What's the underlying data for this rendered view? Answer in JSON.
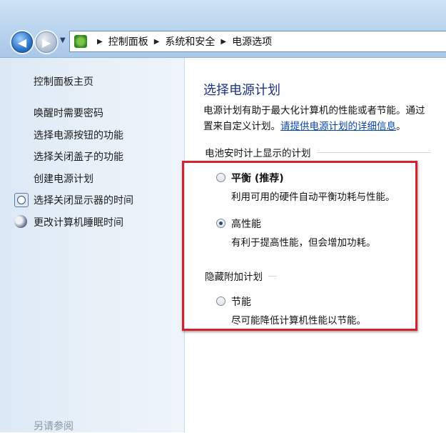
{
  "breadcrumb": {
    "items": [
      "控制面板",
      "系统和安全",
      "电源选项"
    ]
  },
  "sidebar": {
    "home": "控制面板主页",
    "items": [
      {
        "label": "唤醒时需要密码",
        "icon": ""
      },
      {
        "label": "选择电源按钮的功能",
        "icon": ""
      },
      {
        "label": "选择关闭盖子的功能",
        "icon": ""
      },
      {
        "label": "创建电源计划",
        "icon": ""
      },
      {
        "label": "选择关闭显示器的时间",
        "icon": "clock-icon"
      },
      {
        "label": "更改计算机睡眠时间",
        "icon": "moon-icon"
      }
    ],
    "see_also": "另请参阅"
  },
  "main": {
    "title": "选择电源计划",
    "desc_line1": "电源计划有助于最大化计算机的性能或者节能。通过",
    "desc_line2_prefix": "置来自定义计划。",
    "desc_link": "请提供电源计划的详细信息",
    "desc_line2_suffix": "。",
    "group_battery": "电池安时计上显示的计划",
    "group_hidden": "隐藏附加计划",
    "plans": [
      {
        "name": "平衡 (推荐)",
        "desc": "利用可用的硬件自动平衡功耗与性能。",
        "checked": false
      },
      {
        "name": "高性能",
        "desc": "有利于提高性能，但会增加功耗。",
        "checked": true
      },
      {
        "name": "节能",
        "desc": "尽可能降低计算机性能以节能。",
        "checked": false
      }
    ]
  },
  "colors": {
    "title_blue": "#1e3287",
    "link_blue": "#0645ad",
    "highlight_red": "#d6232b"
  }
}
